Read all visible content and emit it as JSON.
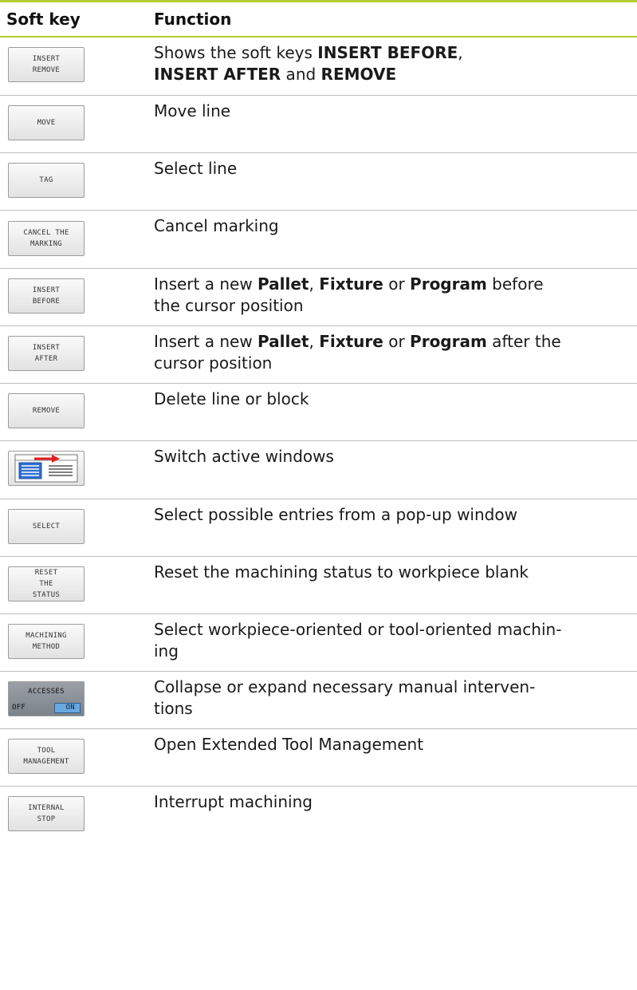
{
  "header": {
    "col_softkey": "Soft key",
    "col_function": "Function"
  },
  "rows": [
    {
      "softkey": [
        "INSERT",
        "REMOVE"
      ],
      "function": [
        [
          "Shows the soft keys ",
          false
        ],
        [
          "INSERT BEFORE",
          true
        ],
        [
          ",",
          false
        ],
        [
          "\n",
          false
        ],
        [
          "INSERT AFTER",
          true
        ],
        [
          " and ",
          false
        ],
        [
          "REMOVE",
          true
        ]
      ]
    },
    {
      "softkey": [
        "MOVE"
      ],
      "function": [
        [
          "Move line",
          false
        ]
      ]
    },
    {
      "softkey": [
        "TAG"
      ],
      "function": [
        [
          "Select line",
          false
        ]
      ]
    },
    {
      "softkey": [
        "CANCEL THE",
        "MARKING"
      ],
      "function": [
        [
          "Cancel marking",
          false
        ]
      ]
    },
    {
      "softkey": [
        "INSERT",
        "BEFORE"
      ],
      "function": [
        [
          "Insert a new ",
          false
        ],
        [
          "Pallet",
          true
        ],
        [
          ", ",
          false
        ],
        [
          "Fixture",
          true
        ],
        [
          " or ",
          false
        ],
        [
          "Program",
          true
        ],
        [
          " before",
          false
        ],
        [
          "\n",
          false
        ],
        [
          "the cursor position",
          false
        ]
      ]
    },
    {
      "softkey": [
        "INSERT",
        "AFTER"
      ],
      "function": [
        [
          "Insert a new ",
          false
        ],
        [
          "Pallet",
          true
        ],
        [
          ", ",
          false
        ],
        [
          "Fixture",
          true
        ],
        [
          " or ",
          false
        ],
        [
          "Program",
          true
        ],
        [
          " after the",
          false
        ],
        [
          "\n",
          false
        ],
        [
          "cursor position",
          false
        ]
      ]
    },
    {
      "softkey": [
        "REMOVE"
      ],
      "function": [
        [
          "Delete line or block",
          false
        ]
      ]
    },
    {
      "softkey": [],
      "icon": "switch-windows-icon",
      "function": [
        [
          "Switch active windows",
          false
        ]
      ]
    },
    {
      "softkey": [
        "SELECT"
      ],
      "function": [
        [
          "Select possible entries from a pop-up window",
          false
        ]
      ]
    },
    {
      "softkey": [
        "RESET",
        "THE",
        "STATUS"
      ],
      "function": [
        [
          "Reset the machining status to workpiece blank",
          false
        ]
      ]
    },
    {
      "softkey": [
        "MACHINING",
        "METHOD"
      ],
      "function": [
        [
          "Select workpiece-oriented or tool-oriented machin-",
          false
        ],
        [
          "\n",
          false
        ],
        [
          "ing",
          false
        ]
      ]
    },
    {
      "softkey": [
        "ACCESSES",
        "OFF",
        "ON"
      ],
      "toggle": true,
      "function": [
        [
          "Collapse or expand necessary manual interven-",
          false
        ],
        [
          "\n",
          false
        ],
        [
          "tions",
          false
        ]
      ]
    },
    {
      "softkey": [
        "TOOL",
        "MANAGEMENT"
      ],
      "function": [
        [
          "Open Extended Tool Management",
          false
        ]
      ]
    },
    {
      "softkey": [
        "INTERNAL",
        "STOP"
      ],
      "function": [
        [
          "Interrupt machining",
          false
        ]
      ]
    }
  ],
  "colors": {
    "accent": "#b5cc2e",
    "toggle_on": "#6aa8e0",
    "icon_blue": "#2f6fd0",
    "arrow_red": "#e02020"
  }
}
